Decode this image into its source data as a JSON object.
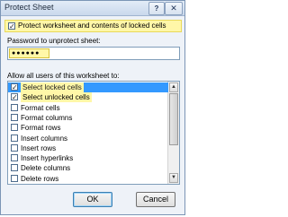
{
  "window": {
    "title": "Protect Sheet",
    "help_label": "?",
    "close_label": "✕"
  },
  "protect": {
    "label": "Protect worksheet and contents of locked cells",
    "checked": true
  },
  "password": {
    "label": "Password to unprotect sheet:",
    "value": "●●●●●●"
  },
  "allow": {
    "label": "Allow all users of this worksheet to:",
    "items": [
      {
        "label": "Select locked cells",
        "checked": true,
        "mark": "✓"
      },
      {
        "label": "Select unlocked cells",
        "checked": true,
        "mark": "✓"
      },
      {
        "label": "Format cells",
        "checked": false,
        "mark": ""
      },
      {
        "label": "Format columns",
        "checked": false,
        "mark": ""
      },
      {
        "label": "Format rows",
        "checked": false,
        "mark": ""
      },
      {
        "label": "Insert columns",
        "checked": false,
        "mark": ""
      },
      {
        "label": "Insert rows",
        "checked": false,
        "mark": ""
      },
      {
        "label": "Insert hyperlinks",
        "checked": false,
        "mark": ""
      },
      {
        "label": "Delete columns",
        "checked": false,
        "mark": ""
      },
      {
        "label": "Delete rows",
        "checked": false,
        "mark": ""
      }
    ]
  },
  "buttons": {
    "ok": "OK",
    "cancel": "Cancel"
  },
  "icons": {
    "checkmark": "check-icon",
    "scroll_up": "scroll-up-arrow-icon",
    "scroll_down": "scroll-down-arrow-icon"
  },
  "colors": {
    "highlight": "#fff7a8",
    "selection": "#3399ff"
  }
}
